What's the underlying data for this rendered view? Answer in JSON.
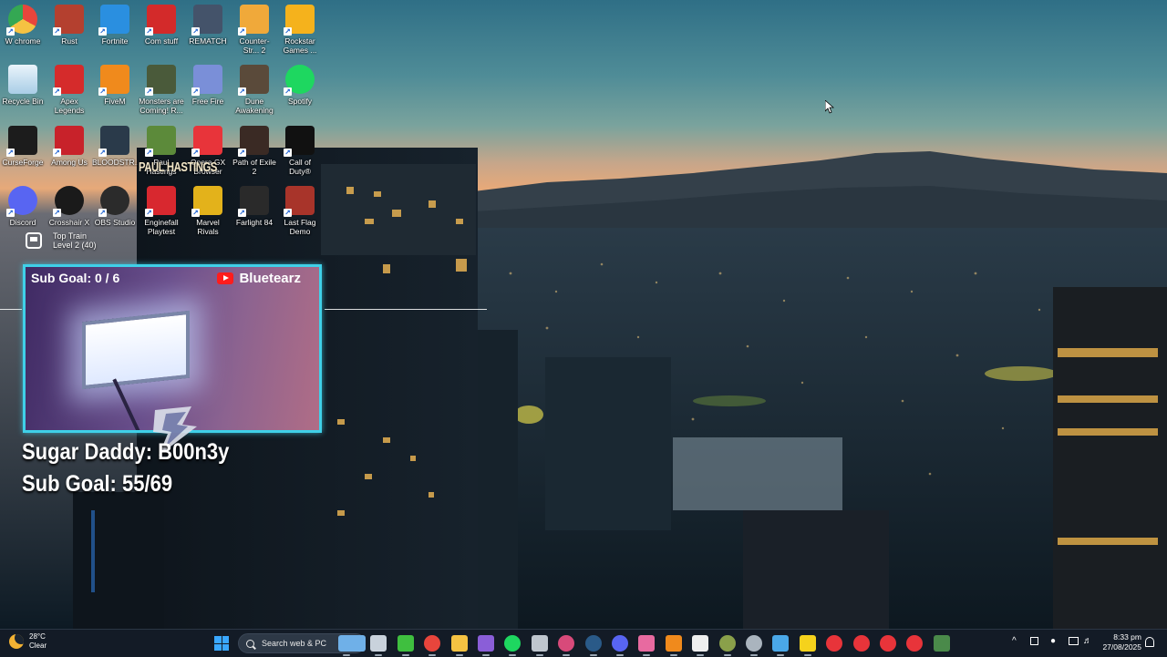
{
  "desktop_icons": [
    {
      "label": "W chrome",
      "icon": "chrome-icon",
      "color": "#e8453c"
    },
    {
      "label": "Rust",
      "icon": "rust-icon",
      "color": "#b4402f"
    },
    {
      "label": "Fortnite",
      "icon": "fortnite-icon",
      "color": "#2a8fe0"
    },
    {
      "label": "Com stuff",
      "icon": "power-icon",
      "color": "#d32a2a"
    },
    {
      "label": "REMATCH",
      "icon": "ball-icon",
      "color": "#44536a"
    },
    {
      "label": "Counter-Str... 2",
      "icon": "cs2-icon",
      "color": "#f0a93a"
    },
    {
      "label": "Rockstar Games ...",
      "icon": "rockstar-icon",
      "color": "#f5b21c"
    },
    {
      "label": "Recycle Bin",
      "icon": "recycle-bin-icon",
      "color": "#cfe4f4"
    },
    {
      "label": "Apex Legends",
      "icon": "apex-icon",
      "color": "#d52b2b"
    },
    {
      "label": "FiveM",
      "icon": "fivem-icon",
      "color": "#f08a1c"
    },
    {
      "label": "Monsters are Coming! R...",
      "icon": "monsters-icon",
      "color": "#4a5a3a"
    },
    {
      "label": "Free Fire",
      "icon": "free-fire-icon",
      "color": "#7a8fd8"
    },
    {
      "label": "Dune Awakening",
      "icon": "dune-icon",
      "color": "#5a4a3a"
    },
    {
      "label": "Spotify",
      "icon": "spotify-icon",
      "color": "#1ed760"
    },
    {
      "label": "CurseForge",
      "icon": "curseforge-icon",
      "color": "#1c1c1c"
    },
    {
      "label": "Among Us",
      "icon": "among-us-icon",
      "color": "#c8222a"
    },
    {
      "label": "BLOODSTR...",
      "icon": "bloodstrike-icon",
      "color": "#2a3a4a"
    },
    {
      "label": "Paul Hastings",
      "icon": "goblin-icon",
      "color": "#5c8a3a"
    },
    {
      "label": "Opera GX Browser",
      "icon": "opera-gx-icon",
      "color": "#e8343a"
    },
    {
      "label": "Path of Exile 2",
      "icon": "poe-icon",
      "color": "#3a2a24"
    },
    {
      "label": "Call of Duty®",
      "icon": "cod-icon",
      "color": "#111111"
    },
    {
      "label": "Discord",
      "icon": "discord-icon",
      "color": "#5865f2"
    },
    {
      "label": "Crosshair X",
      "icon": "crosshair-icon",
      "color": "#1a1a1a"
    },
    {
      "label": "OBS Studio",
      "icon": "obs-icon",
      "color": "#2b2b2b"
    },
    {
      "label": "Enginefall Playtest",
      "icon": "enginefall-icon",
      "color": "#d8282f"
    },
    {
      "label": "Marvel Rivals",
      "icon": "marvel-rivals-icon",
      "color": "#e3b21b"
    },
    {
      "label": "Farlight 84",
      "icon": "farlight-icon",
      "color": "#2a2a2a"
    },
    {
      "label": "Last Flag Demo",
      "icon": "last-flag-icon",
      "color": "#a8342a"
    }
  ],
  "widget": {
    "title": "Top Train",
    "subtitle": "Level 2  (40)"
  },
  "overlay": {
    "cam_subgoal": "Sub Goal:  0 / 6",
    "channel": "Bluetearz",
    "line1": "Sugar Daddy: B00n3y",
    "line2": "Sub Goal: 55/69",
    "building_sign": "PAUL HASTINGS"
  },
  "taskbar": {
    "weather_temp": "28°C",
    "weather_desc": "Clear",
    "search_placeholder": "Search web & PC",
    "apps": [
      {
        "icon": "widgets-icon",
        "color": "#6fb0e8"
      },
      {
        "icon": "task-view-icon",
        "color": "#c9d2dc"
      },
      {
        "icon": "xbox-icon",
        "color": "#3fbf3f"
      },
      {
        "icon": "chrome-icon",
        "color": "#e8453c"
      },
      {
        "icon": "file-explorer-icon",
        "color": "#f5c242"
      },
      {
        "icon": "visual-studio-icon",
        "color": "#8a5ed8"
      },
      {
        "icon": "spotify-icon",
        "color": "#1ed760"
      },
      {
        "icon": "ubisoft-icon",
        "color": "#bfc6ce"
      },
      {
        "icon": "maps-icon",
        "color": "#d84a7a"
      },
      {
        "icon": "steam-icon",
        "color": "#2a5a88"
      },
      {
        "icon": "discord-icon",
        "color": "#5865f2"
      },
      {
        "icon": "photos-icon",
        "color": "#e86aa0"
      },
      {
        "icon": "vlc-icon",
        "color": "#f08a1c"
      },
      {
        "icon": "epic-games-icon",
        "color": "#eeeeee"
      },
      {
        "icon": "xbox-app-icon",
        "color": "#8aa04a"
      },
      {
        "icon": "obs-icon",
        "color": "#aab4be"
      },
      {
        "icon": "screenshot-icon",
        "color": "#4aa8e8"
      },
      {
        "icon": "sticky-notes-icon",
        "color": "#f5d21c"
      },
      {
        "icon": "record-icon",
        "color": "#e8343a"
      },
      {
        "icon": "opera-gx-icon",
        "color": "#e8343a"
      },
      {
        "icon": "faceit-icon",
        "color": "#e8343a"
      },
      {
        "icon": "opera-gx-icon",
        "color": "#e8343a"
      },
      {
        "icon": "nvidia-icon",
        "color": "#4a8a4a"
      }
    ],
    "time": "8:33 pm",
    "date": "27/08/2025"
  }
}
